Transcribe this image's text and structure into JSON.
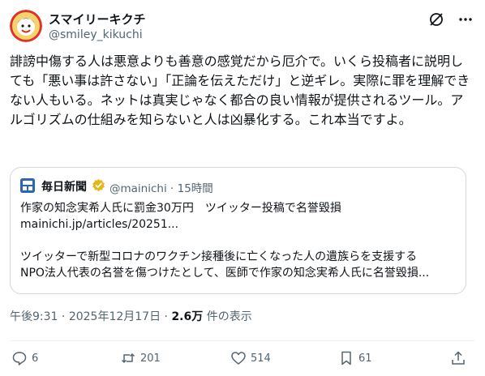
{
  "author": {
    "name": "スマイリーキクチ",
    "handle": "@smiley_kikuchi",
    "avatar_icon": "avatar-icon"
  },
  "tweet": {
    "text": "誹謗中傷する人は悪意よりも善意の感覚だから厄介で。いくら投稿者に説明しても「悪い事は許さない」「正論を伝えただけ」と逆ギレ。実際に罪を理解できない人もいる。ネットは真実じゃなく都合の良い情報が提供されるツール。アルゴリズムの仕組みを知らないと人は凶暴化する。これ本当ですよ。"
  },
  "quote": {
    "source_name": "毎日新聞",
    "handle": "@mainichi",
    "time": "15時間",
    "headline": "作家の知念実希人氏に罰金30万円　ツイッター投稿で名誉毀損",
    "link": "mainichi.jp/articles/20251...",
    "snippet_line1": "ツイッターで新型コロナのワクチン接種後に亡くなった人の遺族らを支援する",
    "snippet_line2": "NPO法人代表の名誉を傷つけたとして、医師で作家の知念実希人氏に名誉毀損..."
  },
  "meta": {
    "time": "午後9:31",
    "date": "2025年12月17日",
    "views_count": "2.6万",
    "views_label": "件の表示"
  },
  "actions": {
    "reply_count": "6",
    "retweet_count": "201",
    "like_count": "514",
    "bookmark_count": "61"
  },
  "colors": {
    "text": "#0f1419",
    "secondary": "#536471",
    "border": "#cfd9de",
    "badge": "#e2b719",
    "logo": "#2a67b0"
  }
}
